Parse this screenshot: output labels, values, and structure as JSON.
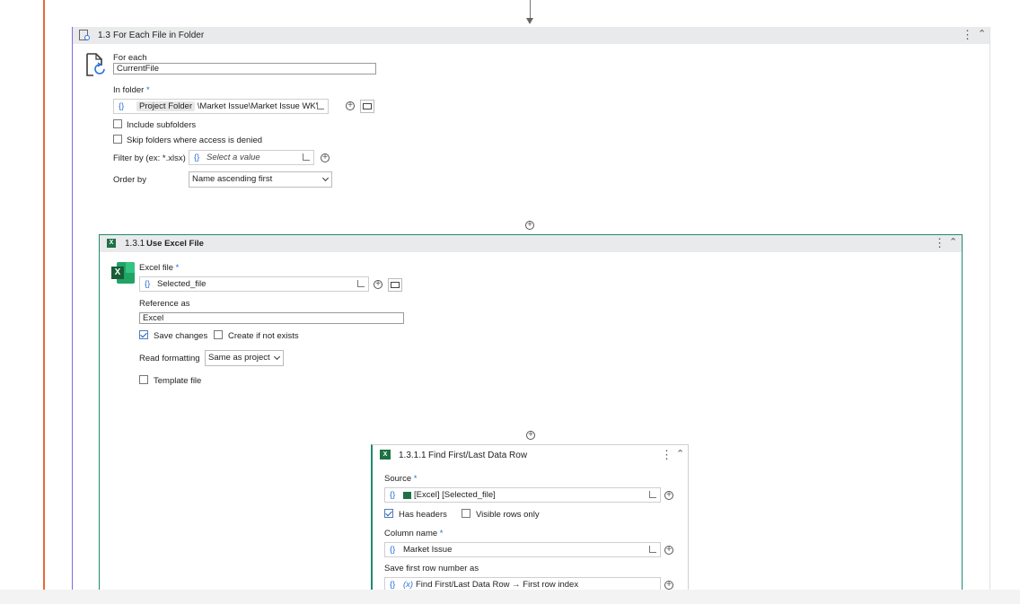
{
  "outer": {
    "step": "1.3",
    "title": "For Each File in Folder",
    "for_each_label": "For each",
    "for_each_value": "CurrentFile",
    "in_folder_label": "In folder",
    "in_folder_chip": "Project Folder",
    "in_folder_path": "\\Market Issue\\Market Issue  WK'",
    "include_subfolders": "Include subfolders",
    "skip_folders": "Skip folders where access is denied",
    "filter_label": "Filter by (ex: *.xlsx)",
    "filter_placeholder": "Select a value",
    "order_label": "Order by",
    "order_value": "Name ascending first"
  },
  "excel": {
    "step": "1.3.1",
    "title": "Use Excel File",
    "excel_file_label": "Excel file",
    "excel_file_value": "Selected_file",
    "reference_label": "Reference as",
    "reference_value": "Excel",
    "save_changes": "Save changes",
    "save_changes_checked": true,
    "create_if_not_exists": "Create if not exists",
    "read_formatting_label": "Read formatting",
    "read_formatting_value": "Same as project",
    "template_file": "Template file"
  },
  "find": {
    "step": "1.3.1.1",
    "title": "Find First/Last Data Row",
    "source_label": "Source",
    "source_value": "[Excel] [Selected_file]",
    "has_headers": "Has headers",
    "has_headers_checked": true,
    "visible_rows_only": "Visible rows only",
    "column_name_label": "Column name",
    "column_name_value": "Market Issue",
    "save_first_label": "Save first row number as",
    "save_first_value": "Find First/Last Data Row → First row index"
  },
  "common": {
    "required_mark": "*",
    "brace_glyph": "{}",
    "kebab_glyph": "⋮",
    "collapse_glyph": "˄",
    "excel_letter": "X"
  },
  "colors": {
    "orange_line": "#e8683a",
    "purple_line": "#6b5bd6",
    "teal_border": "#1f8a70",
    "header_bg": "#e9eaeb",
    "excel_green": "#1e7145"
  }
}
